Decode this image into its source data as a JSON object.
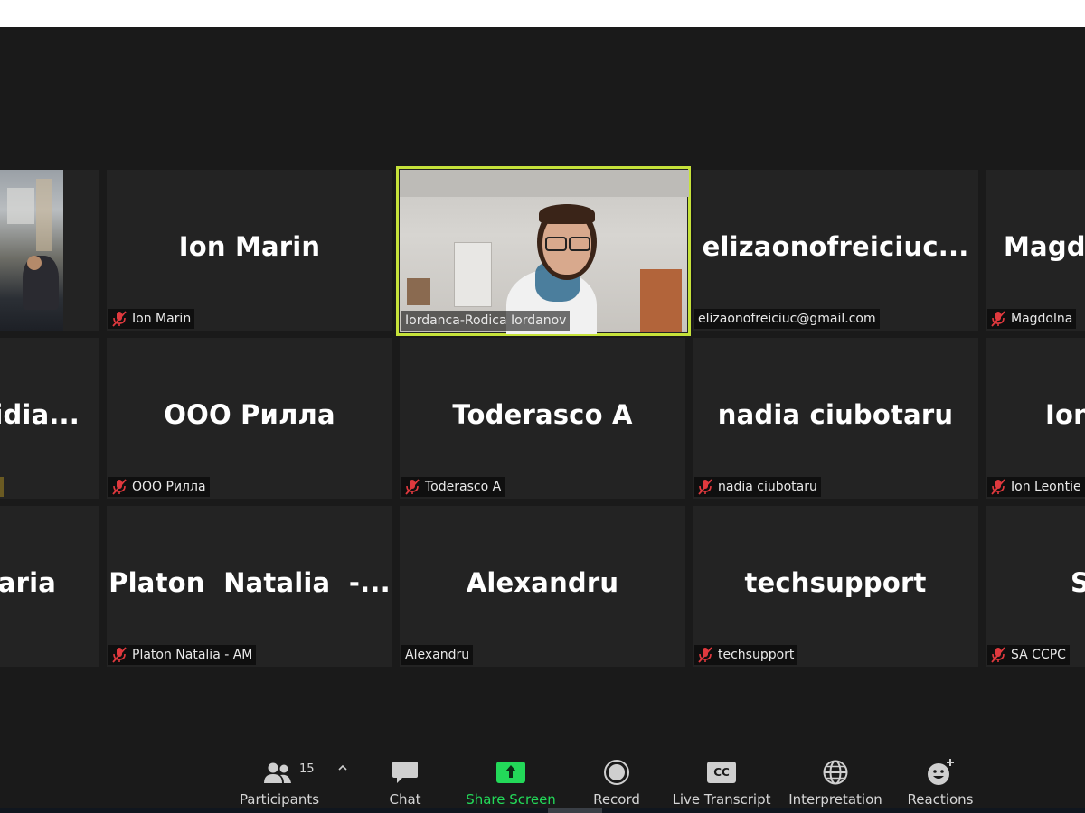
{
  "tiles": {
    "r1c2": {
      "big": "Ion Marin",
      "label": "Ion Marin"
    },
    "r1c3": {
      "label": "Iordanca-Rodica Iordanov"
    },
    "r1c4": {
      "big": "elizaonofreiciuc...",
      "label": "elizaonofreiciuc@gmail.com"
    },
    "r1c5": {
      "big": "Magdo",
      "label": "Magdolna"
    },
    "r2c1": {
      "big": "Lidia..."
    },
    "r2c2": {
      "big": "ООО Рилла",
      "label": "ООО Рилла"
    },
    "r2c3": {
      "big": "Toderasco A",
      "label": "Toderasco A"
    },
    "r2c4": {
      "big": "nadia ciubotaru",
      "label": "nadia ciubotaru"
    },
    "r2c5": {
      "big": "Ion",
      "label": "Ion Leontie"
    },
    "r3c1": {
      "big": "Maria"
    },
    "r3c2": {
      "big": "Platon  Natalia  -...",
      "label": "Platon Natalia - AM"
    },
    "r3c3": {
      "big": "Alexandru",
      "label": "Alexandru"
    },
    "r3c4": {
      "big": "techsupport",
      "label": "techsupport"
    },
    "r3c5": {
      "big": "S",
      "label": "SA CCPC"
    }
  },
  "toolbar": {
    "participants_label": "Participants",
    "participants_count": "15",
    "chat_label": "Chat",
    "share_label": "Share Screen",
    "record_label": "Record",
    "transcript_label": "Live Transcript",
    "cc_text": "CC",
    "interpretation_label": "Interpretation",
    "reactions_label": "Reactions"
  },
  "colors": {
    "active_speaker_border": "#c6e23a",
    "share_green": "#23d959",
    "muted_red": "#e0393e"
  }
}
